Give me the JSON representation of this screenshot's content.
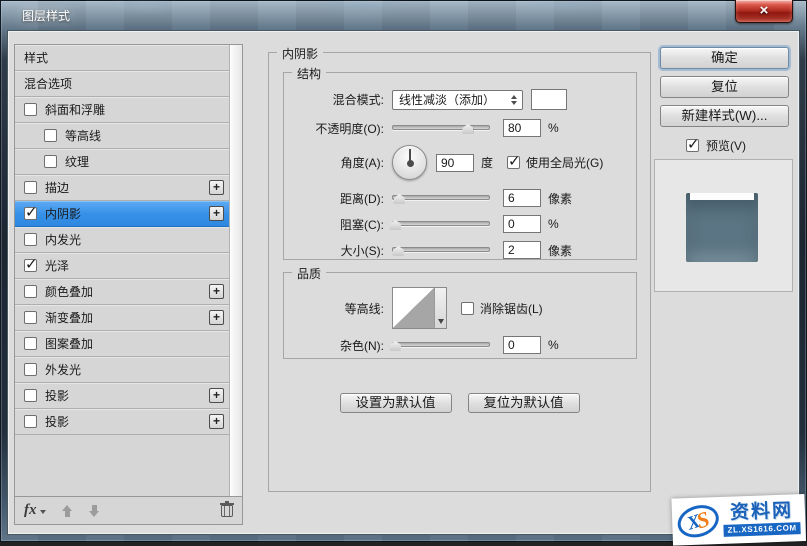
{
  "window": {
    "title": "图层样式",
    "close_glyph": "×"
  },
  "sidebar": {
    "items": [
      {
        "label": "样式",
        "checkbox": false,
        "checked": false,
        "plus": false,
        "selected": false,
        "indent": false
      },
      {
        "label": "混合选项",
        "checkbox": false,
        "checked": false,
        "plus": false,
        "selected": false,
        "indent": false
      },
      {
        "label": "斜面和浮雕",
        "checkbox": true,
        "checked": false,
        "plus": false,
        "selected": false,
        "indent": false
      },
      {
        "label": "等高线",
        "checkbox": true,
        "checked": false,
        "plus": false,
        "selected": false,
        "indent": true
      },
      {
        "label": "纹理",
        "checkbox": true,
        "checked": false,
        "plus": false,
        "selected": false,
        "indent": true
      },
      {
        "label": "描边",
        "checkbox": true,
        "checked": false,
        "plus": true,
        "selected": false,
        "indent": false
      },
      {
        "label": "内阴影",
        "checkbox": true,
        "checked": true,
        "plus": true,
        "selected": true,
        "indent": false
      },
      {
        "label": "内发光",
        "checkbox": true,
        "checked": false,
        "plus": false,
        "selected": false,
        "indent": false
      },
      {
        "label": "光泽",
        "checkbox": true,
        "checked": true,
        "plus": false,
        "selected": false,
        "indent": false
      },
      {
        "label": "颜色叠加",
        "checkbox": true,
        "checked": false,
        "plus": true,
        "selected": false,
        "indent": false
      },
      {
        "label": "渐变叠加",
        "checkbox": true,
        "checked": false,
        "plus": true,
        "selected": false,
        "indent": false
      },
      {
        "label": "图案叠加",
        "checkbox": true,
        "checked": false,
        "plus": false,
        "selected": false,
        "indent": false
      },
      {
        "label": "外发光",
        "checkbox": true,
        "checked": false,
        "plus": false,
        "selected": false,
        "indent": false
      },
      {
        "label": "投影",
        "checkbox": true,
        "checked": false,
        "plus": true,
        "selected": false,
        "indent": false
      },
      {
        "label": "投影",
        "checkbox": true,
        "checked": false,
        "plus": true,
        "selected": false,
        "indent": false
      }
    ],
    "toolbar": {
      "fx_label": "fx"
    }
  },
  "panel": {
    "title": "内阴影",
    "structure": {
      "title": "结构",
      "blend_mode_label": "混合模式:",
      "blend_mode_value": "线性减淡（添加）",
      "opacity_label": "不透明度(O):",
      "opacity_value": "80",
      "opacity_unit": "%",
      "angle_label": "角度(A):",
      "angle_value": "90",
      "angle_unit": "度",
      "global_light_label": "使用全局光(G)",
      "global_light_checked": true,
      "distance_label": "距离(D):",
      "distance_value": "6",
      "distance_unit": "像素",
      "choke_label": "阻塞(C):",
      "choke_value": "0",
      "choke_unit": "%",
      "size_label": "大小(S):",
      "size_value": "2",
      "size_unit": "像素"
    },
    "quality": {
      "title": "品质",
      "contour_label": "等高线:",
      "antialias_label": "消除锯齿(L)",
      "antialias_checked": false,
      "noise_label": "杂色(N):",
      "noise_value": "0",
      "noise_unit": "%"
    },
    "buttons": {
      "set_default": "设置为默认值",
      "reset_default": "复位为默认值"
    }
  },
  "actions": {
    "ok": "确定",
    "reset": "复位",
    "new_style": "新建样式(W)...",
    "preview": "预览(V)",
    "preview_checked": true
  },
  "watermark": {
    "logo_x": "X",
    "logo_s": "S",
    "site_name": "资料网",
    "site_url": "ZL.XS1616.COM"
  },
  "colors": {
    "dialog_bg": "#dcdcdc",
    "selection_blue": "#3590e7",
    "close_red": "#b12d21",
    "preview_square": "#5b7584",
    "watermark_blue": "#1766c4",
    "watermark_orange": "#f07d17"
  }
}
